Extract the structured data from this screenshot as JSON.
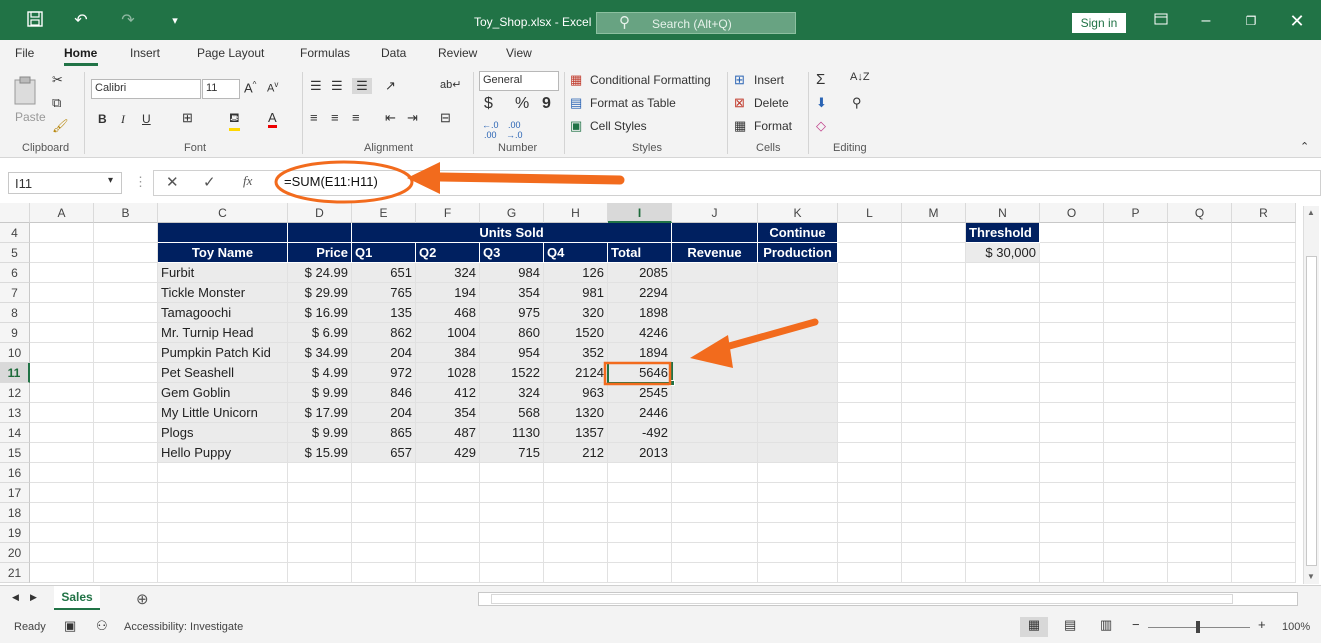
{
  "window": {
    "title": "Toy_Shop.xlsx - Excel",
    "search_placeholder": "Search (Alt+Q)",
    "sign_in": "Sign in"
  },
  "menu": [
    "File",
    "Home",
    "Insert",
    "Page Layout",
    "Formulas",
    "Data",
    "Review",
    "View"
  ],
  "ribbon": {
    "clipboard": {
      "paste": "Paste",
      "label": "Clipboard"
    },
    "font": {
      "name": "Calibri",
      "size": "11",
      "label": "Font",
      "bold": "B",
      "italic": "I",
      "underline": "U"
    },
    "alignment": {
      "label": "Alignment"
    },
    "number": {
      "format": "General",
      "currency": "$",
      "percent": "%",
      "comma": "9",
      "label": "Number"
    },
    "styles": {
      "conditional": "Conditional Formatting",
      "format_table": "Format as Table",
      "cell_styles": "Cell Styles",
      "label": "Styles"
    },
    "cells": {
      "insert": "Insert",
      "delete": "Delete",
      "format": "Format",
      "label": "Cells"
    },
    "editing": {
      "label": "Editing"
    }
  },
  "formula_bar": {
    "name_box": "I11",
    "fx": "fx",
    "formula": "=SUM(E11:H11)"
  },
  "columns": [
    "A",
    "B",
    "C",
    "D",
    "E",
    "F",
    "G",
    "H",
    "I",
    "J",
    "K",
    "L",
    "M",
    "N",
    "O",
    "P",
    "Q",
    "R"
  ],
  "rows": [
    "4",
    "5",
    "6",
    "7",
    "8",
    "9",
    "10",
    "11",
    "12",
    "13",
    "14",
    "15",
    "16",
    "17",
    "18",
    "19",
    "20",
    "21"
  ],
  "table": {
    "header_units_sold": "Units Sold",
    "toy_name": "Toy Name",
    "price": "Price",
    "q1": "Q1",
    "q2": "Q2",
    "q3": "Q3",
    "q4": "Q4",
    "total": "Total",
    "revenue": "Revenue",
    "continue_1": "Continue",
    "continue_2": "Production",
    "threshold_label": "Threshold",
    "threshold_value": "$ 30,000",
    "rows": [
      {
        "name": "Furbit",
        "price": "$ 24.99",
        "q1": "651",
        "q2": "324",
        "q3": "984",
        "q4": "126",
        "total": "2085"
      },
      {
        "name": "Tickle Monster",
        "price": "$ 29.99",
        "q1": "765",
        "q2": "194",
        "q3": "354",
        "q4": "981",
        "total": "2294"
      },
      {
        "name": "Tamagoochi",
        "price": "$ 16.99",
        "q1": "135",
        "q2": "468",
        "q3": "975",
        "q4": "320",
        "total": "1898"
      },
      {
        "name": "Mr. Turnip Head",
        "price": "$ 6.99",
        "q1": "862",
        "q2": "1004",
        "q3": "860",
        "q4": "1520",
        "total": "4246"
      },
      {
        "name": "Pumpkin Patch Kid",
        "price": "$ 34.99",
        "q1": "204",
        "q2": "384",
        "q3": "954",
        "q4": "352",
        "total": "1894"
      },
      {
        "name": "Pet Seashell",
        "price": "$ 4.99",
        "q1": "972",
        "q2": "1028",
        "q3": "1522",
        "q4": "2124",
        "total": "5646"
      },
      {
        "name": "Gem Goblin",
        "price": "$ 9.99",
        "q1": "846",
        "q2": "412",
        "q3": "324",
        "q4": "963",
        "total": "2545"
      },
      {
        "name": "My Little Unicorn",
        "price": "$ 17.99",
        "q1": "204",
        "q2": "354",
        "q3": "568",
        "q4": "1320",
        "total": "2446"
      },
      {
        "name": "Plogs",
        "price": "$ 9.99",
        "q1": "865",
        "q2": "487",
        "q3": "1130",
        "q4": "1357",
        "total": "-492"
      },
      {
        "name": "Hello Puppy",
        "price": "$ 15.99",
        "q1": "657",
        "q2": "429",
        "q3": "715",
        "q4": "212",
        "total": "2013"
      }
    ]
  },
  "sheet_tab": "Sales",
  "status": {
    "ready": "Ready",
    "accessibility": "Accessibility: Investigate",
    "zoom": "100%"
  },
  "colors": {
    "accent": "#217346",
    "header_fill": "#002060",
    "annotation": "#f26b1d"
  }
}
